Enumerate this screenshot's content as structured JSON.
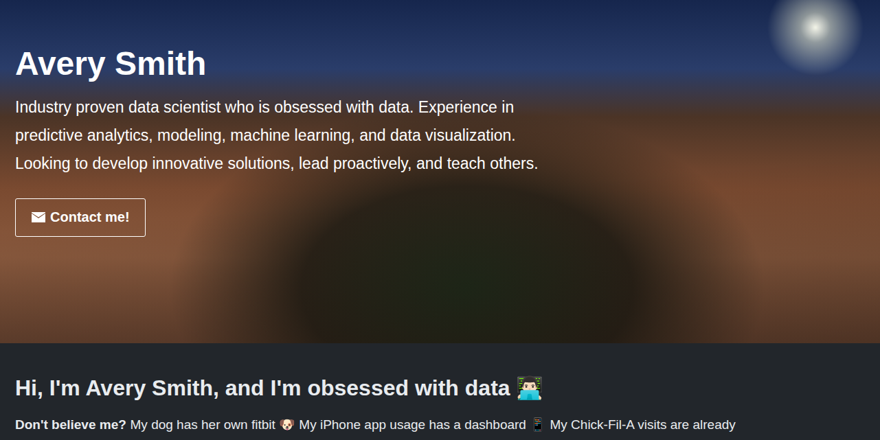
{
  "hero": {
    "title": "Avery Smith",
    "tagline": "Industry proven data scientist who is obsessed with data. Experience in predictive analytics, modeling, machine learning, and data visualization. Looking to develop innovative solutions, lead proactively, and teach others.",
    "contact_button": {
      "label": "Contact me!"
    }
  },
  "about": {
    "heading": "Hi, I'm Avery Smith, and I'm obsessed with data 👨🏻‍💻",
    "lead": "Don't believe me?",
    "text": "My dog has her own fitbit 🐶 My iPhone app usage has a dashboard 📱 My Chick-Fil-A visits are already"
  }
}
